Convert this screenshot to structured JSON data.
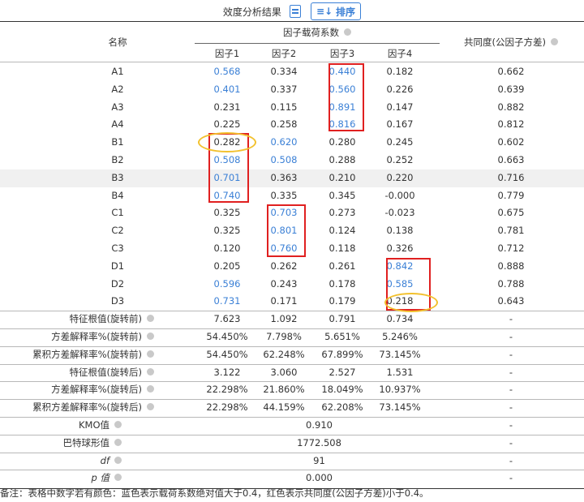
{
  "toolbar": {
    "title": "效度分析结果",
    "sort_label": "排序"
  },
  "header": {
    "name_col": "名称",
    "loading_group": "因子载荷系数",
    "factors": [
      "因子1",
      "因子2",
      "因子3",
      "因子4"
    ],
    "communality": "共同度(公因子方差)"
  },
  "rows": [
    {
      "name": "A1",
      "v": [
        "0.568",
        "0.334",
        "0.440",
        "0.182"
      ],
      "c": "0.662",
      "blue": [
        true,
        false,
        true,
        false
      ]
    },
    {
      "name": "A2",
      "v": [
        "0.401",
        "0.337",
        "0.560",
        "0.226"
      ],
      "c": "0.639",
      "blue": [
        true,
        false,
        true,
        false
      ]
    },
    {
      "name": "A3",
      "v": [
        "0.231",
        "0.115",
        "0.891",
        "0.147"
      ],
      "c": "0.882",
      "blue": [
        false,
        false,
        true,
        false
      ]
    },
    {
      "name": "A4",
      "v": [
        "0.225",
        "0.258",
        "0.816",
        "0.167"
      ],
      "c": "0.812",
      "blue": [
        false,
        false,
        true,
        false
      ]
    },
    {
      "name": "B1",
      "v": [
        "0.282",
        "0.620",
        "0.280",
        "0.245"
      ],
      "c": "0.602",
      "blue": [
        false,
        true,
        false,
        false
      ]
    },
    {
      "name": "B2",
      "v": [
        "0.508",
        "0.508",
        "0.288",
        "0.252"
      ],
      "c": "0.663",
      "blue": [
        true,
        true,
        false,
        false
      ]
    },
    {
      "name": "B3",
      "v": [
        "0.701",
        "0.363",
        "0.210",
        "0.220"
      ],
      "c": "0.716",
      "blue": [
        true,
        false,
        false,
        false
      ]
    },
    {
      "name": "B4",
      "v": [
        "0.740",
        "0.335",
        "0.345",
        "-0.000"
      ],
      "c": "0.779",
      "blue": [
        true,
        false,
        false,
        false
      ]
    },
    {
      "name": "C1",
      "v": [
        "0.325",
        "0.703",
        "0.273",
        "-0.023"
      ],
      "c": "0.675",
      "blue": [
        false,
        true,
        false,
        false
      ]
    },
    {
      "name": "C2",
      "v": [
        "0.325",
        "0.801",
        "0.124",
        "0.138"
      ],
      "c": "0.781",
      "blue": [
        false,
        true,
        false,
        false
      ]
    },
    {
      "name": "C3",
      "v": [
        "0.120",
        "0.760",
        "0.118",
        "0.326"
      ],
      "c": "0.712",
      "blue": [
        false,
        true,
        false,
        false
      ]
    },
    {
      "name": "D1",
      "v": [
        "0.205",
        "0.262",
        "0.261",
        "0.842"
      ],
      "c": "0.888",
      "blue": [
        false,
        false,
        false,
        true
      ]
    },
    {
      "name": "D2",
      "v": [
        "0.596",
        "0.243",
        "0.178",
        "0.585"
      ],
      "c": "0.788",
      "blue": [
        true,
        false,
        false,
        true
      ]
    },
    {
      "name": "D3",
      "v": [
        "0.731",
        "0.171",
        "0.179",
        "0.218"
      ],
      "c": "0.643",
      "blue": [
        true,
        false,
        false,
        false
      ]
    }
  ],
  "stats": [
    {
      "name": "特征根值(旋转前)",
      "v": [
        "7.623",
        "1.092",
        "0.791",
        "0.734"
      ],
      "c": "-"
    },
    {
      "name": "方差解释率%(旋转前)",
      "v": [
        "54.450%",
        "7.798%",
        "5.651%",
        "5.246%"
      ],
      "c": "-"
    },
    {
      "name": "累积方差解释率%(旋转前)",
      "v": [
        "54.450%",
        "62.248%",
        "67.899%",
        "73.145%"
      ],
      "c": "-"
    },
    {
      "name": "特征根值(旋转后)",
      "v": [
        "3.122",
        "3.060",
        "2.527",
        "1.531"
      ],
      "c": "-"
    },
    {
      "name": "方差解释率%(旋转后)",
      "v": [
        "22.298%",
        "21.860%",
        "18.049%",
        "10.937%"
      ],
      "c": "-"
    },
    {
      "name": "累积方差解释率%(旋转后)",
      "v": [
        "22.298%",
        "44.159%",
        "62.208%",
        "73.145%"
      ],
      "c": "-"
    }
  ],
  "tests": [
    {
      "name": "KMO值",
      "v": "0.910",
      "c": "-"
    },
    {
      "name": "巴特球形值",
      "v": "1772.508",
      "c": "-"
    },
    {
      "name": "df",
      "v": "91",
      "c": "-"
    },
    {
      "name": "p 值",
      "v": "0.000",
      "c": "-"
    }
  ],
  "note": "备注：表格中数字若有颜色：蓝色表示载荷系数绝对值大于0.4，红色表示共同度(公因子方差)小于0.4。",
  "colors": {
    "blue": "#3b80d6",
    "box": "#e02020",
    "oval": "#f2c12e"
  }
}
